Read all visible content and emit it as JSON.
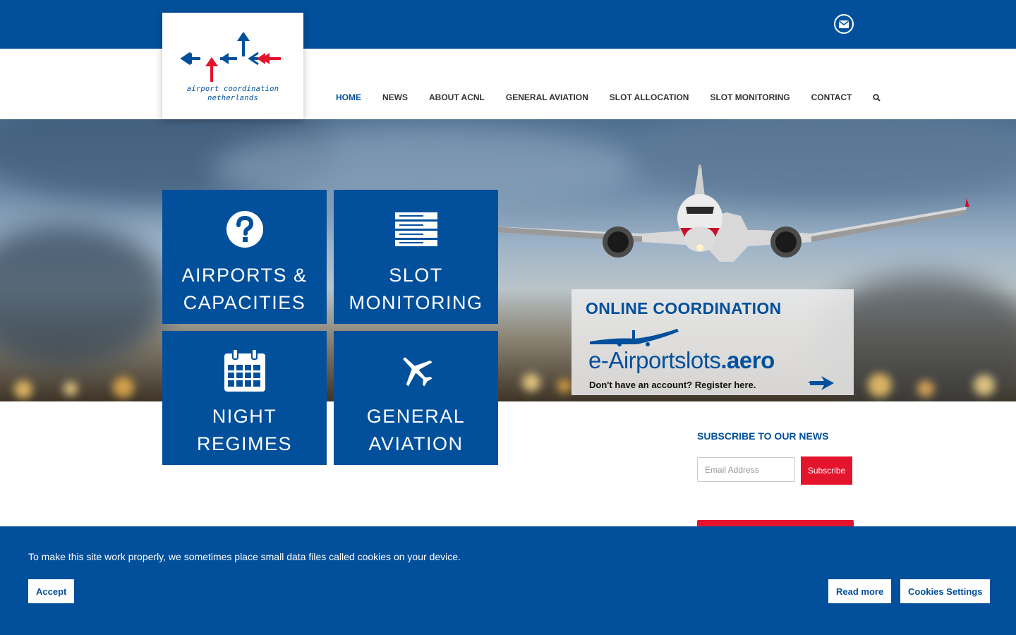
{
  "colors": {
    "brand_blue": "#02509c",
    "accent_red": "#e4142d",
    "white": "#ffffff"
  },
  "topbar": {
    "mail_icon": "envelope-icon"
  },
  "logo": {
    "line1": "airport coordination",
    "line2": "netherlands"
  },
  "nav": {
    "items": [
      "HOME",
      "NEWS",
      "ABOUT ACNL",
      "GENERAL AVIATION",
      "SLOT ALLOCATION",
      "SLOT MONITORING",
      "CONTACT"
    ],
    "active": "HOME",
    "search_icon": "search-icon"
  },
  "tiles": [
    {
      "line1": "AIRPORTS &",
      "line2": "CAPACITIES",
      "icon": "question-circle-icon"
    },
    {
      "line1": "SLOT",
      "line2": "MONITORING",
      "icon": "server-list-icon"
    },
    {
      "line1": "NIGHT",
      "line2": "REGIMES",
      "icon": "calendar-icon"
    },
    {
      "line1": "GENERAL",
      "line2": "AVIATION",
      "icon": "plane-icon"
    }
  ],
  "online": {
    "title": "ONLINE COORDINATION",
    "brand_prefix": "e-Airportslots",
    "brand_suffix": ".aero",
    "register": "Don't have an account? Register here."
  },
  "subscribe": {
    "title": "SUBSCRIBE TO OUR NEWS",
    "placeholder": "Email Address",
    "button": "Subscribe"
  },
  "cookie": {
    "text": "To make this site work properly, we sometimes place small data files called cookies on your device.",
    "accept": "Accept",
    "read_more": "Read more",
    "settings": "Cookies Settings"
  }
}
